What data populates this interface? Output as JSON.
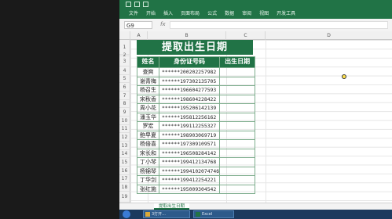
{
  "ribbon": {
    "tabs": [
      "文件",
      "开始",
      "插入",
      "页面布局",
      "公式",
      "数据",
      "审阅",
      "视图",
      "开发工具"
    ]
  },
  "formula_bar": {
    "name_box": "G9",
    "fx_label": "fx"
  },
  "columns": [
    "A",
    "B",
    "C",
    "D"
  ],
  "rows": [
    "1",
    "2",
    "3",
    "4",
    "5",
    "6",
    "7",
    "8",
    "9",
    "10",
    "11",
    "12",
    "13",
    "14",
    "15",
    "16",
    "17",
    "18",
    "19"
  ],
  "sheet": {
    "title": "提取出生日期",
    "headers": {
      "name": "姓名",
      "id": "身份证号码",
      "birth": "出生日期"
    },
    "records": [
      {
        "name": "查爽",
        "id": "******200202257982"
      },
      {
        "name": "谢青梅",
        "id": "******197302135705"
      },
      {
        "name": "杨召生",
        "id": "******196604277593"
      },
      {
        "name": "宋秋香",
        "id": "******198604228422"
      },
      {
        "name": "周小花",
        "id": "******195206142139"
      },
      {
        "name": "潘玉华",
        "id": "******195812256162"
      },
      {
        "name": "罗宏",
        "id": "******199112255327"
      },
      {
        "name": "鲍早夏",
        "id": "******198903069719"
      },
      {
        "name": "杨倍喜",
        "id": "******197309109571"
      },
      {
        "name": "宋长和",
        "id": "******196508284142"
      },
      {
        "name": "丁小琴",
        "id": "******199412134768"
      },
      {
        "name": "杨锦琴",
        "id": "******199410207474б"
      },
      {
        "name": "丁华剑",
        "id": "******199412254221"
      },
      {
        "name": "张红施",
        "id": "******195009304542"
      }
    ]
  },
  "sheet_tab": {
    "label": "提取出生日期"
  },
  "taskbar": {
    "items": [
      "3打开...",
      "Excel"
    ]
  },
  "colors": {
    "accent": "#217346"
  }
}
